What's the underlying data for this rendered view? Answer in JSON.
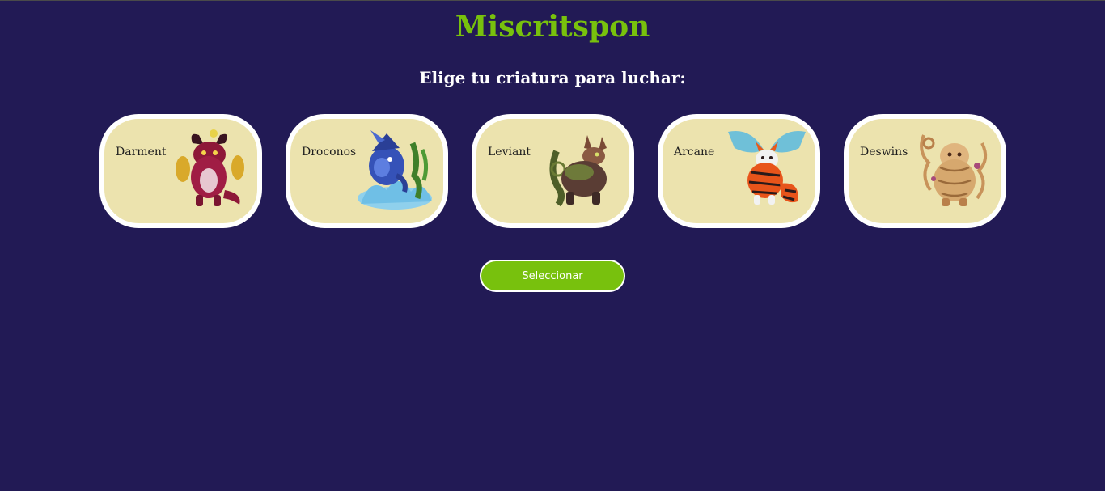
{
  "header": {
    "title": "Miscritspon",
    "subtitle": "Elige tu criatura para luchar:"
  },
  "colors": {
    "background": "#221a55",
    "title": "#78c10d",
    "card_fill": "#ece3ae",
    "card_border": "#ffffff",
    "button": "#78c10d"
  },
  "creatures": [
    {
      "name": "Darment",
      "icon": "red-horned-demon-creature-image"
    },
    {
      "name": "Droconos",
      "icon": "blue-water-dragon-creature-image"
    },
    {
      "name": "Leviant",
      "icon": "brown-leaf-beast-creature-image"
    },
    {
      "name": "Arcane",
      "icon": "winged-fire-fox-creature-image"
    },
    {
      "name": "Deswins",
      "icon": "golden-tentacle-spirit-creature-image"
    }
  ],
  "actions": {
    "select_label": "Seleccionar"
  }
}
